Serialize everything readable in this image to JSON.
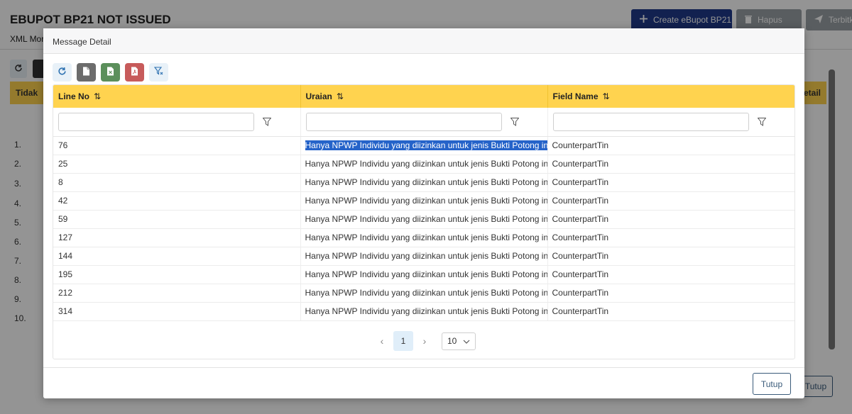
{
  "background": {
    "title": "EBUPOT BP21 NOT ISSUED",
    "create_label": "Create eBupot BP21",
    "hapus_label": "Hapus",
    "terbitkan_label": "Terbitka",
    "sub_label": "XML Mor",
    "header_left": "Tidak",
    "header_right": "etail",
    "row_numbers": [
      "1.",
      "2.",
      "3.",
      "4.",
      "5.",
      "6.",
      "7.",
      "8.",
      "9.",
      "10."
    ],
    "tutup_label": "Tutup"
  },
  "modal": {
    "title": "Message Detail",
    "columns": [
      {
        "label": "Line No"
      },
      {
        "label": "Uraian"
      },
      {
        "label": "Field Name"
      }
    ],
    "filters": {
      "line_no": "",
      "uraian": "",
      "field_name": ""
    },
    "rows": [
      {
        "line_no": "76",
        "uraian": "Hanya NPWP Individu yang diizinkan untuk jenis Bukti Potong ini",
        "field_name": "CounterpartTin"
      },
      {
        "line_no": "25",
        "uraian": "Hanya NPWP Individu yang diizinkan untuk jenis Bukti Potong ini",
        "field_name": "CounterpartTin"
      },
      {
        "line_no": "8",
        "uraian": "Hanya NPWP Individu yang diizinkan untuk jenis Bukti Potong ini",
        "field_name": "CounterpartTin"
      },
      {
        "line_no": "42",
        "uraian": "Hanya NPWP Individu yang diizinkan untuk jenis Bukti Potong ini",
        "field_name": "CounterpartTin"
      },
      {
        "line_no": "59",
        "uraian": "Hanya NPWP Individu yang diizinkan untuk jenis Bukti Potong ini",
        "field_name": "CounterpartTin"
      },
      {
        "line_no": "127",
        "uraian": "Hanya NPWP Individu yang diizinkan untuk jenis Bukti Potong ini",
        "field_name": "CounterpartTin"
      },
      {
        "line_no": "144",
        "uraian": "Hanya NPWP Individu yang diizinkan untuk jenis Bukti Potong ini",
        "field_name": "CounterpartTin"
      },
      {
        "line_no": "195",
        "uraian": "Hanya NPWP Individu yang diizinkan untuk jenis Bukti Potong ini",
        "field_name": "CounterpartTin"
      },
      {
        "line_no": "212",
        "uraian": "Hanya NPWP Individu yang diizinkan untuk jenis Bukti Potong ini",
        "field_name": "CounterpartTin"
      },
      {
        "line_no": "314",
        "uraian": "Hanya NPWP Individu yang diizinkan untuk jenis Bukti Potong ini",
        "field_name": "CounterpartTin"
      }
    ],
    "pagination": {
      "current_page": "1",
      "page_size": "10"
    },
    "close_label": "Tutup"
  },
  "colors": {
    "header_yellow": "#ffd34f",
    "primary_navy": "#1f3a8a",
    "selection_blue": "#2563c9"
  }
}
